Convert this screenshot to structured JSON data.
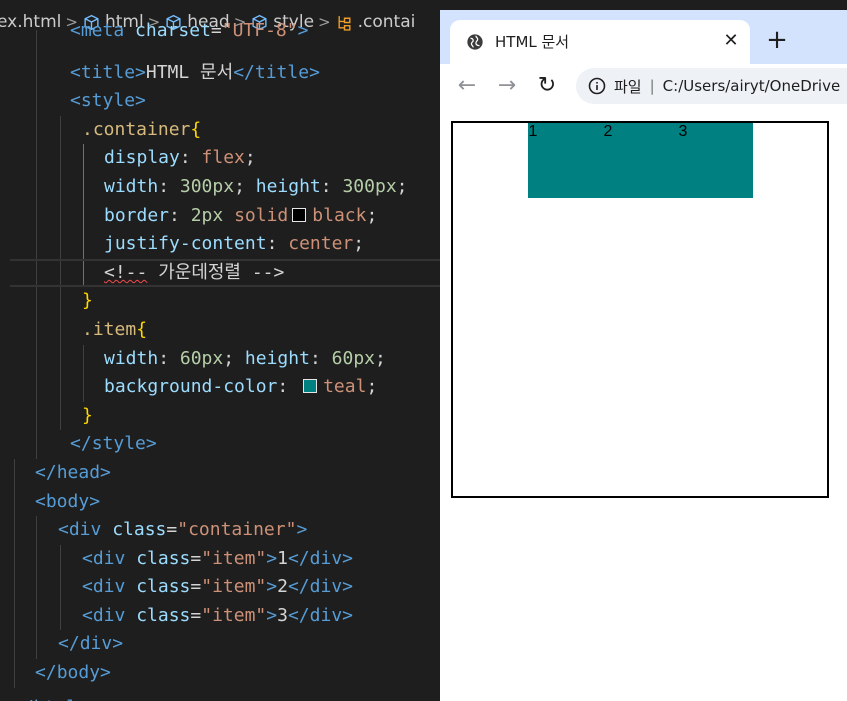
{
  "breadcrumb": [
    {
      "label": "ex.html",
      "icon": "file-icon"
    },
    {
      "label": "html",
      "icon": "cube-icon"
    },
    {
      "label": "head",
      "icon": "cube-icon"
    },
    {
      "label": "style",
      "icon": "cube-icon"
    },
    {
      "label": ".contai",
      "icon": "symbol-icon"
    }
  ],
  "code": {
    "l1_tag": "meta",
    "l1_attr": "charset",
    "l1_val": "\"UTF-8\"",
    "l2_tag": "title",
    "l2_text": "HTML 문서",
    "l3_tag": "style",
    "l4_sel": ".container",
    "l5_prop": "display",
    "l5_val": "flex",
    "l6_prop1": "width",
    "l6_val1": "300px",
    "l6_prop2": "height",
    "l6_val2": "300px",
    "l7_prop": "border",
    "l7_num": "2px",
    "l7_style": "solid",
    "l7_color": "black",
    "l8_prop": "justify-content",
    "l8_val": "center",
    "l9_comment_open": "<!--",
    "l9_comment_text": " 가운데정렬 -->",
    "l11_sel": ".item",
    "l12_prop1": "width",
    "l12_val1": "60px",
    "l12_prop2": "height",
    "l12_val2": "60px",
    "l13_prop": "background-color",
    "l13_val": "teal",
    "l16_tag": "head",
    "l17_tag": "body",
    "l18_tag": "div",
    "l18_attr": "class",
    "l18_val": "\"container\"",
    "item_tag": "div",
    "item_attr": "class",
    "item_val": "\"item\"",
    "item_texts": [
      "1",
      "2",
      "3"
    ],
    "l22_tag": "div",
    "l23_tag": "body",
    "l24_tag": "html"
  },
  "browser": {
    "tab_title": "HTML 문서",
    "close_glyph": "✕",
    "new_tab_glyph": "+",
    "back_glyph": "←",
    "forward_glyph": "→",
    "reload_glyph": "↻",
    "site_label": "파일",
    "separator": "|",
    "url": "C:/Users/airyt/OneDrive",
    "items": [
      "1",
      "2",
      "3"
    ]
  },
  "colors": {
    "teal": "#008080",
    "black": "#000000",
    "tab_strip": "#d3e3fd"
  }
}
